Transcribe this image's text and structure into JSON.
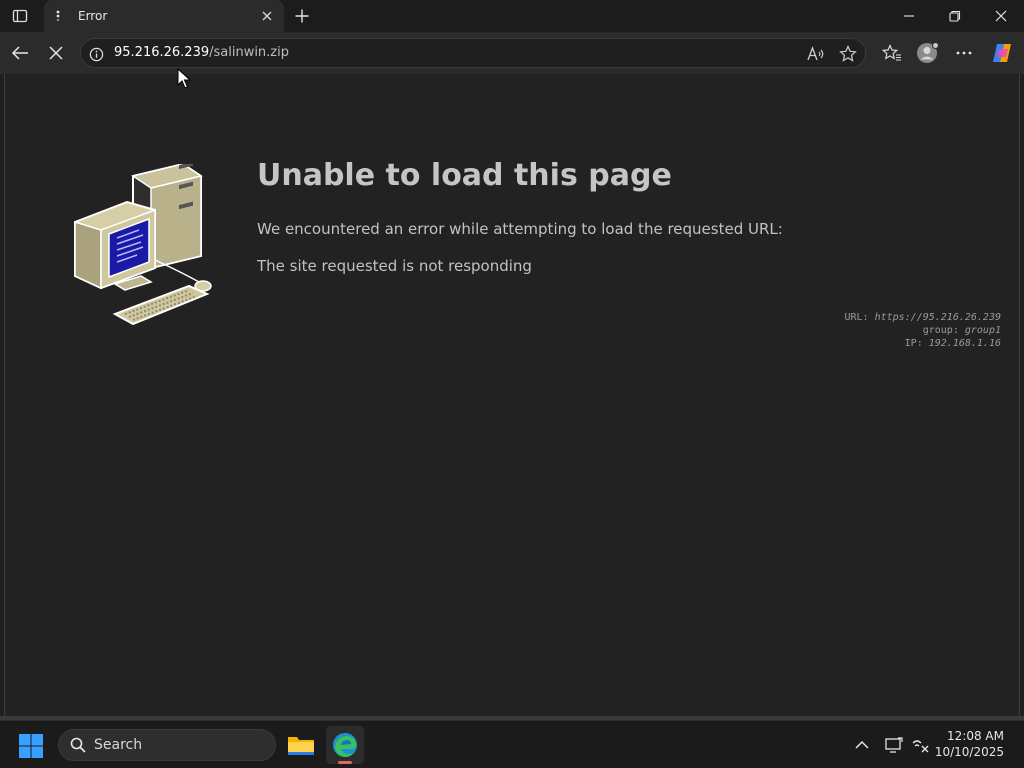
{
  "tab": {
    "title": "Error",
    "close_label": "✕"
  },
  "address_bar": {
    "host": "95.216.26.239",
    "path": "/salinwin.zip"
  },
  "page": {
    "title": "Unable to load this page",
    "description": "We encountered an error while attempting to load the requested URL:",
    "reason": "The site requested is not responding",
    "meta": [
      {
        "label": "URL: ",
        "value": "https://95.216.26.239"
      },
      {
        "label": "group: ",
        "value": "group1"
      },
      {
        "label": "IP: ",
        "value": "192.168.1.16"
      }
    ]
  },
  "taskbar": {
    "search_label": "Search",
    "time": "12:08 AM",
    "date": "10/10/2025"
  },
  "colors": {
    "accent": "#0078d4",
    "screen_blue": "#1a1aa6",
    "edge_indicator": "#e0665e"
  },
  "icons": [
    "tab-actions-icon",
    "loading-icon",
    "close-icon",
    "new-tab-icon",
    "minimize-icon",
    "restore-icon",
    "window-close-icon",
    "back-icon",
    "stop-icon",
    "site-info-icon",
    "read-aloud-icon",
    "favorite-star-icon",
    "favorites-icon",
    "profile-icon",
    "more-icon",
    "copilot-icon",
    "windows-start-icon",
    "search-icon",
    "file-explorer-icon",
    "edge-icon",
    "chevron-up-icon",
    "display-icon",
    "network-muted-icon"
  ]
}
